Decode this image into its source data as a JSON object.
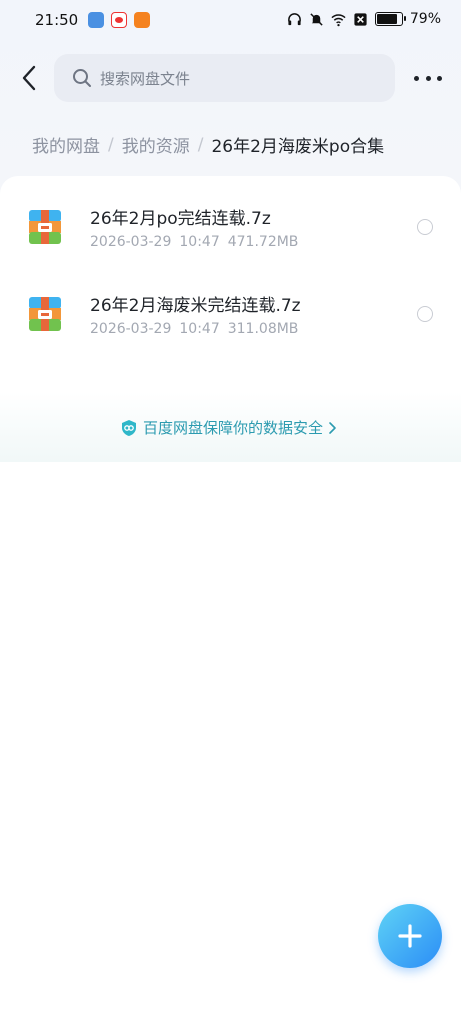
{
  "status_bar": {
    "time": "21:50",
    "battery": "79%"
  },
  "nav": {
    "search_placeholder": "搜索网盘文件"
  },
  "breadcrumb": {
    "items": [
      "我的网盘",
      "我的资源"
    ],
    "current": "26年2月海废米po合集"
  },
  "files": [
    {
      "name": "26年2月po完结连载.7z",
      "date": "2026-03-29",
      "time": "10:47",
      "size": "471.72MB",
      "icon": "archive-icon"
    },
    {
      "name": "26年2月海废米完结连载.7z",
      "date": "2026-03-29",
      "time": "10:47",
      "size": "311.08MB",
      "icon": "archive-icon"
    }
  ],
  "security_note": "百度网盘保障你的数据安全",
  "colors": {
    "accent": "#2b8df7",
    "security_text": "#2c9bb0"
  }
}
